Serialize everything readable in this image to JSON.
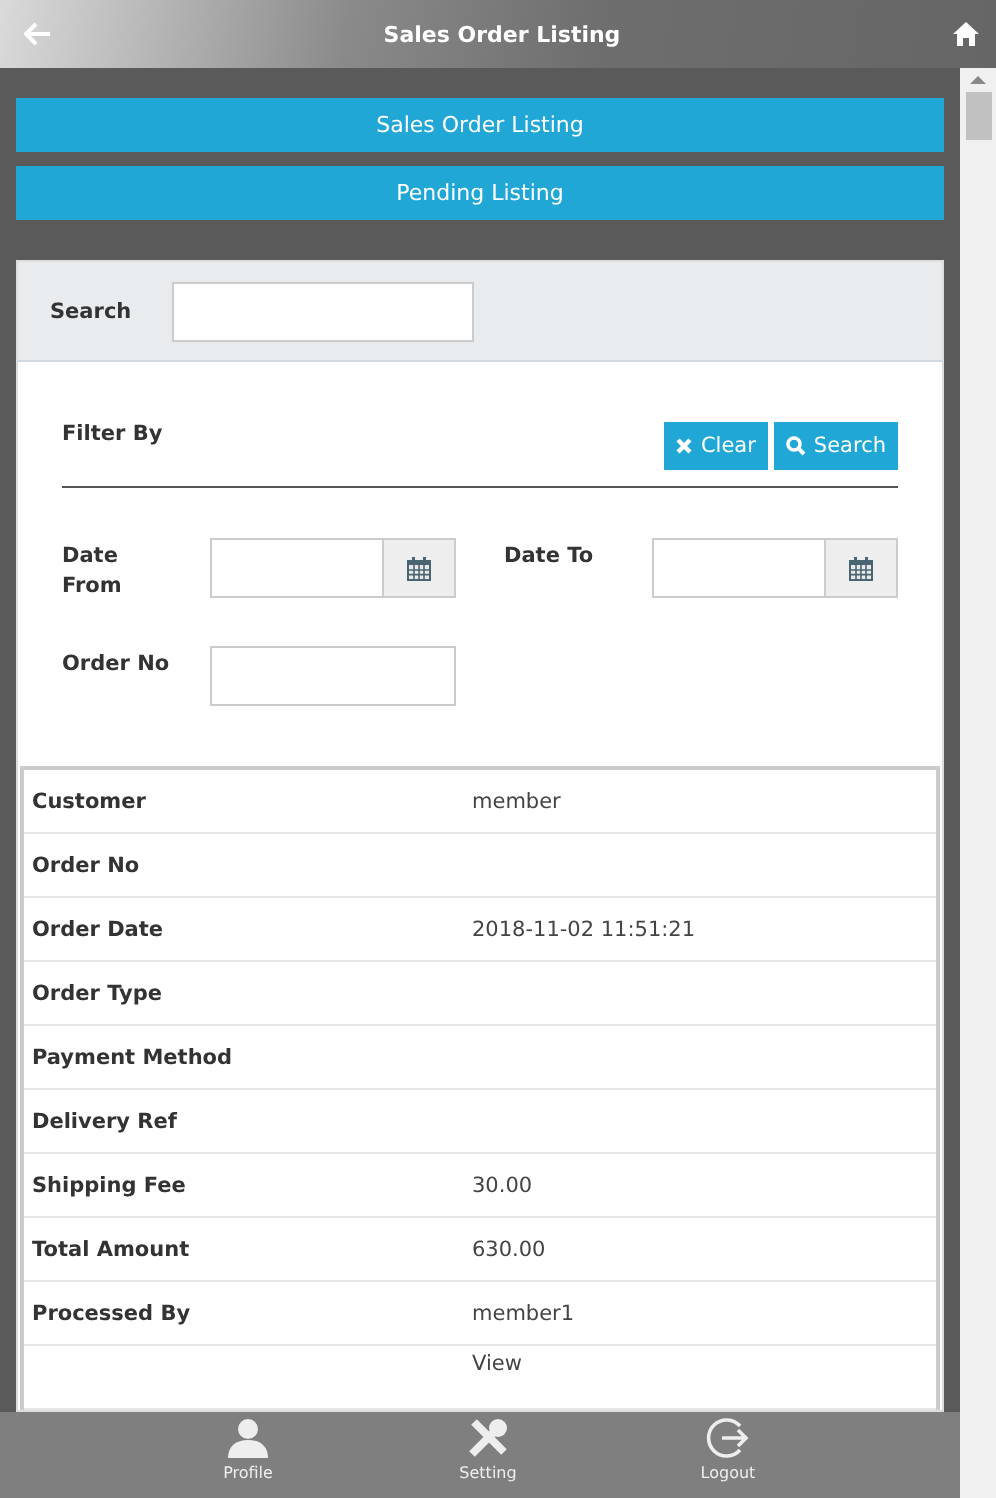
{
  "header": {
    "title": "Sales Order Listing"
  },
  "nav_buttons": [
    {
      "label": "Sales Order Listing"
    },
    {
      "label": "Pending Listing"
    }
  ],
  "search": {
    "label": "Search"
  },
  "filter": {
    "title": "Filter By",
    "clear_label": "Clear",
    "search_label": "Search",
    "date_from_label": "Date From",
    "date_to_label": "Date To",
    "order_no_label": "Order No"
  },
  "details": [
    {
      "label": "Customer",
      "value": "member"
    },
    {
      "label": "Order No"
    },
    {
      "label": "Order Date",
      "value": "2018-11-02 11:51:21"
    },
    {
      "label": "Order Type"
    },
    {
      "label": "Payment Method"
    },
    {
      "label": "Delivery Ref"
    },
    {
      "label": "Shipping Fee",
      "value": "30.00"
    },
    {
      "label": "Total Amount",
      "value": "630.00"
    },
    {
      "label": "Processed By",
      "value": "member1"
    },
    {
      "value": "View"
    }
  ],
  "footer": [
    {
      "kind": "profile",
      "label": "Profile"
    },
    {
      "kind": "setting",
      "label": "Setting"
    },
    {
      "kind": "logout",
      "label": "Logout"
    }
  ]
}
